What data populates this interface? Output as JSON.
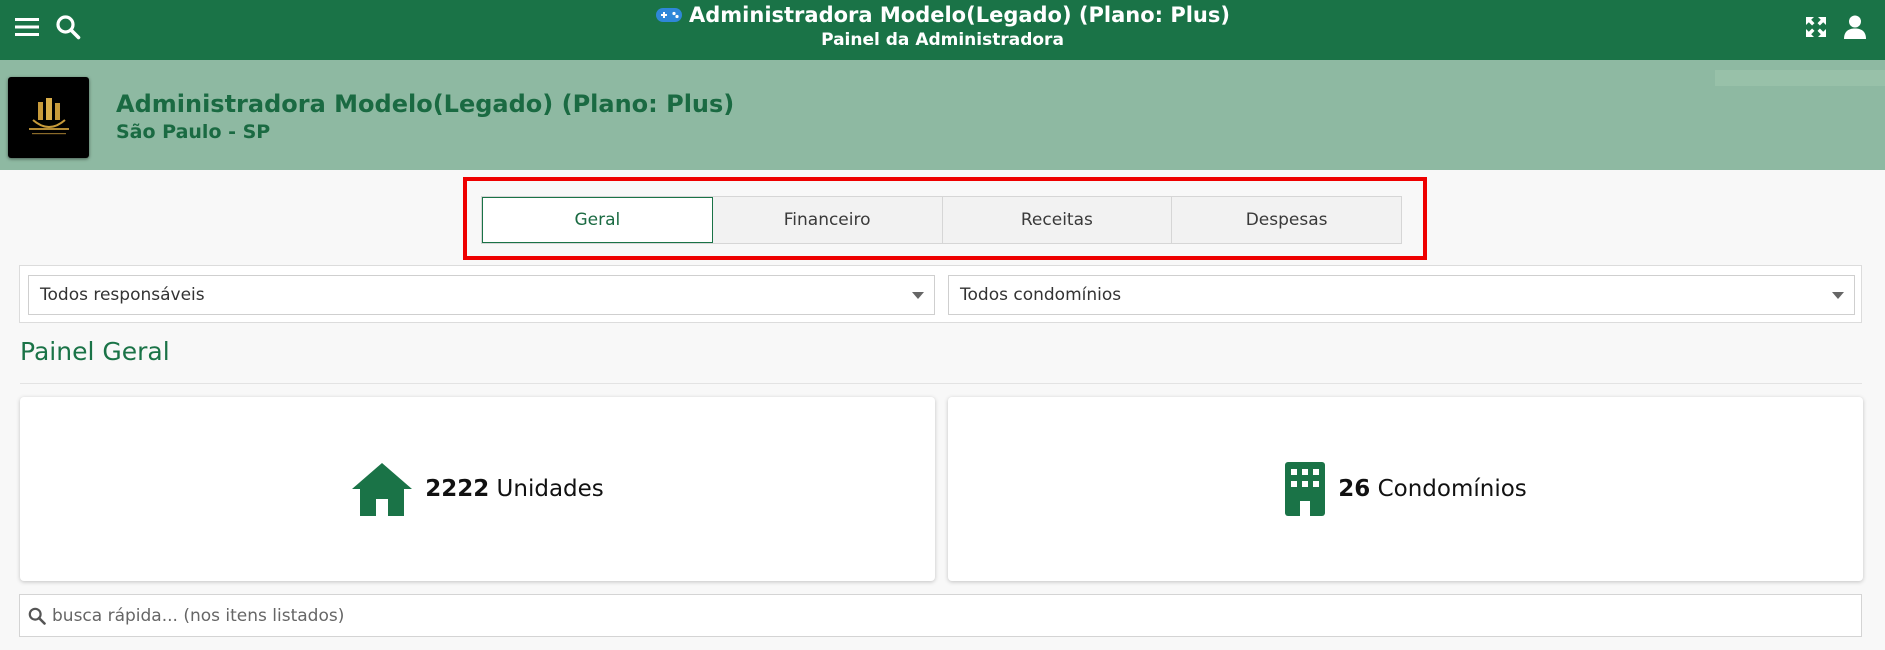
{
  "topbar": {
    "title": "Administradora Modelo(Legado) (Plano: Plus)",
    "subtitle": "Painel da Administradora",
    "icons": {
      "menu": "hamburger-menu-icon",
      "search": "search-icon",
      "badge": "gamepad-icon",
      "expand": "expand-icon",
      "user": "user-icon"
    },
    "color": "#1a7347"
  },
  "banner": {
    "company": "Administradora Modelo(Legado) (Plano: Plus)",
    "city": "São Paulo - SP",
    "color": "#8eb9a2"
  },
  "tabs": [
    {
      "label": "Geral",
      "active": true
    },
    {
      "label": "Financeiro",
      "active": false
    },
    {
      "label": "Receitas",
      "active": false
    },
    {
      "label": "Despesas",
      "active": false
    }
  ],
  "filters": {
    "responsaveis": "Todos responsáveis",
    "condominios": "Todos condomínios"
  },
  "section_title": "Painel Geral",
  "cards": [
    {
      "count": "2222",
      "label": "Unidades",
      "icon": "house-icon"
    },
    {
      "count": "26",
      "label": "Condomínios",
      "icon": "building-icon"
    }
  ],
  "search": {
    "placeholder": "busca rápida... (nos itens listados)"
  },
  "highlight_color": "#ee0000"
}
